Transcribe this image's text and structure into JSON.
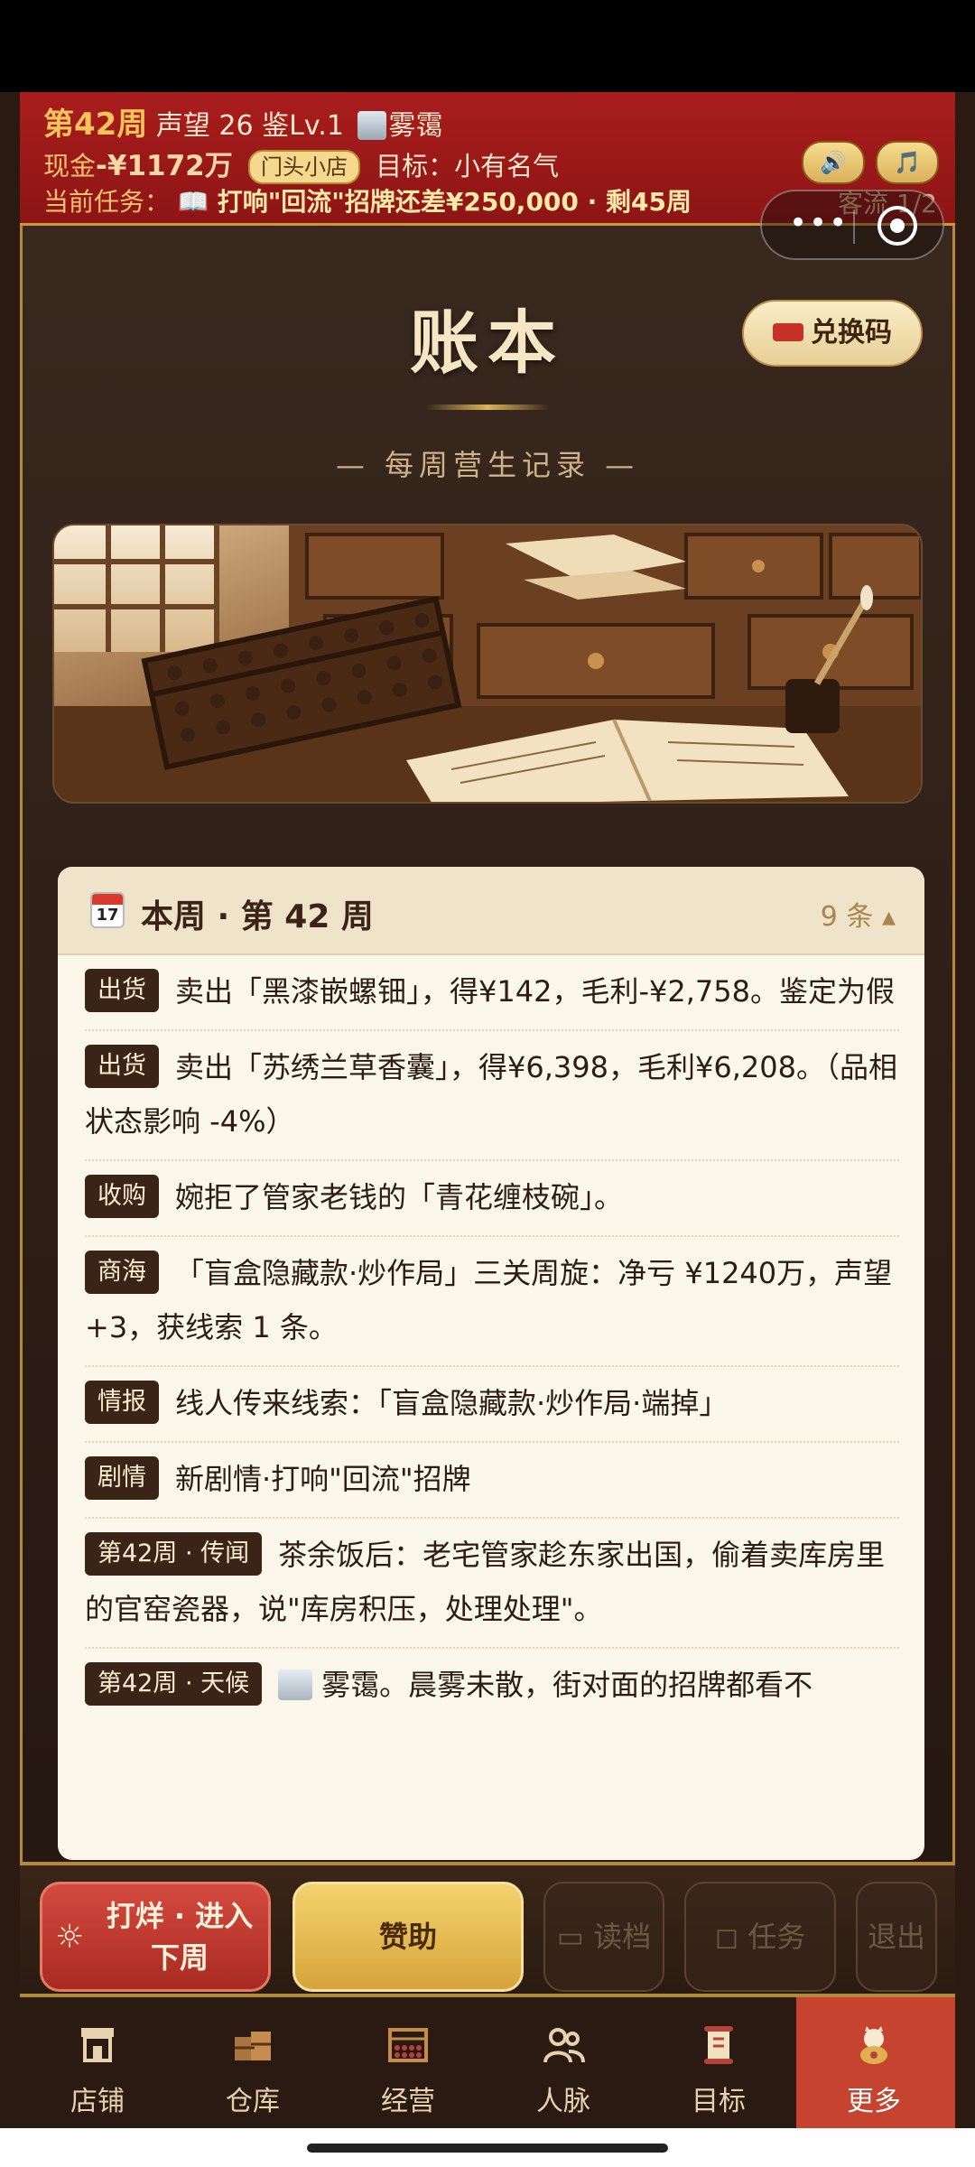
{
  "status": {
    "week": "第42周",
    "reputation": "声望 26",
    "appraise": "鉴Lv.1",
    "weather": "雾霭",
    "cash_label": "现金",
    "cash_value": "-¥1172万",
    "shop_tag": "门头小店",
    "goal": "目标：小有名气",
    "task_label": "当前任务：",
    "task_icon": "📖",
    "task_body": "打响\"回流\"招牌还差¥250,000 · 剩45周",
    "flow": "客流 1/2",
    "sound_icon": "🔊",
    "music_icon": "🎵"
  },
  "capsule": {
    "more": "•••"
  },
  "page": {
    "title": "账本",
    "subtitle": "— 每周营生记录 —",
    "redeem_label": "兑换码"
  },
  "ledger": {
    "calendar_month": "July",
    "calendar_day": "17",
    "title": "本周 · 第 42 周",
    "count": "9 条 ▴",
    "entries": [
      {
        "tag": "出货",
        "text": "卖出「黑漆嵌螺钿」，得¥142，毛利-¥2,758。鉴定为假"
      },
      {
        "tag": "出货",
        "text": "卖出「苏绣兰草香囊」，得¥6,398，毛利¥6,208。（品相状态影响 -4%）"
      },
      {
        "tag": "收购",
        "text": "婉拒了管家老钱的「青花缠枝碗」。"
      },
      {
        "tag": "商海",
        "text": "「盲盒隐藏款·炒作局」三关周旋：净亏 ¥1240万，声望 +3，获线索 1 条。"
      },
      {
        "tag": "情报",
        "text": "线人传来线索：「盲盒隐藏款·炒作局·端掉」"
      },
      {
        "tag": "剧情",
        "text": "新剧情·打响\"回流\"招牌"
      },
      {
        "tag": "第42周 · 传闻",
        "text": "茶余饭后：老宅管家趁东家出国，偷着卖库房里的官窑瓷器，说\"库房积压，处理处理\"。"
      },
      {
        "tag": "第42周 · 天候",
        "text": "雾霭。晨雾未散，街对面的招牌都看不"
      }
    ]
  },
  "actions": {
    "close_icon": "☼",
    "close_label": "打烊 · 进入下周",
    "sponsor_label": "赞助",
    "load_label": "读档",
    "task_label": "任务",
    "exit_label": "退出"
  },
  "nav": {
    "items": [
      {
        "label": "店铺",
        "icon": "shop-icon"
      },
      {
        "label": "仓库",
        "icon": "warehouse-icon"
      },
      {
        "label": "经营",
        "icon": "business-icon"
      },
      {
        "label": "人脉",
        "icon": "people-icon"
      },
      {
        "label": "目标",
        "icon": "goal-icon"
      },
      {
        "label": "更多",
        "icon": "more-icon"
      }
    ],
    "active": "更多"
  },
  "colors": {
    "status_red": "#a91d1d",
    "gold_border": "#b18a3b",
    "card_bg": "#fbf6ea",
    "tag_bg": "#3a2418",
    "nav_active": "#c6432f"
  }
}
